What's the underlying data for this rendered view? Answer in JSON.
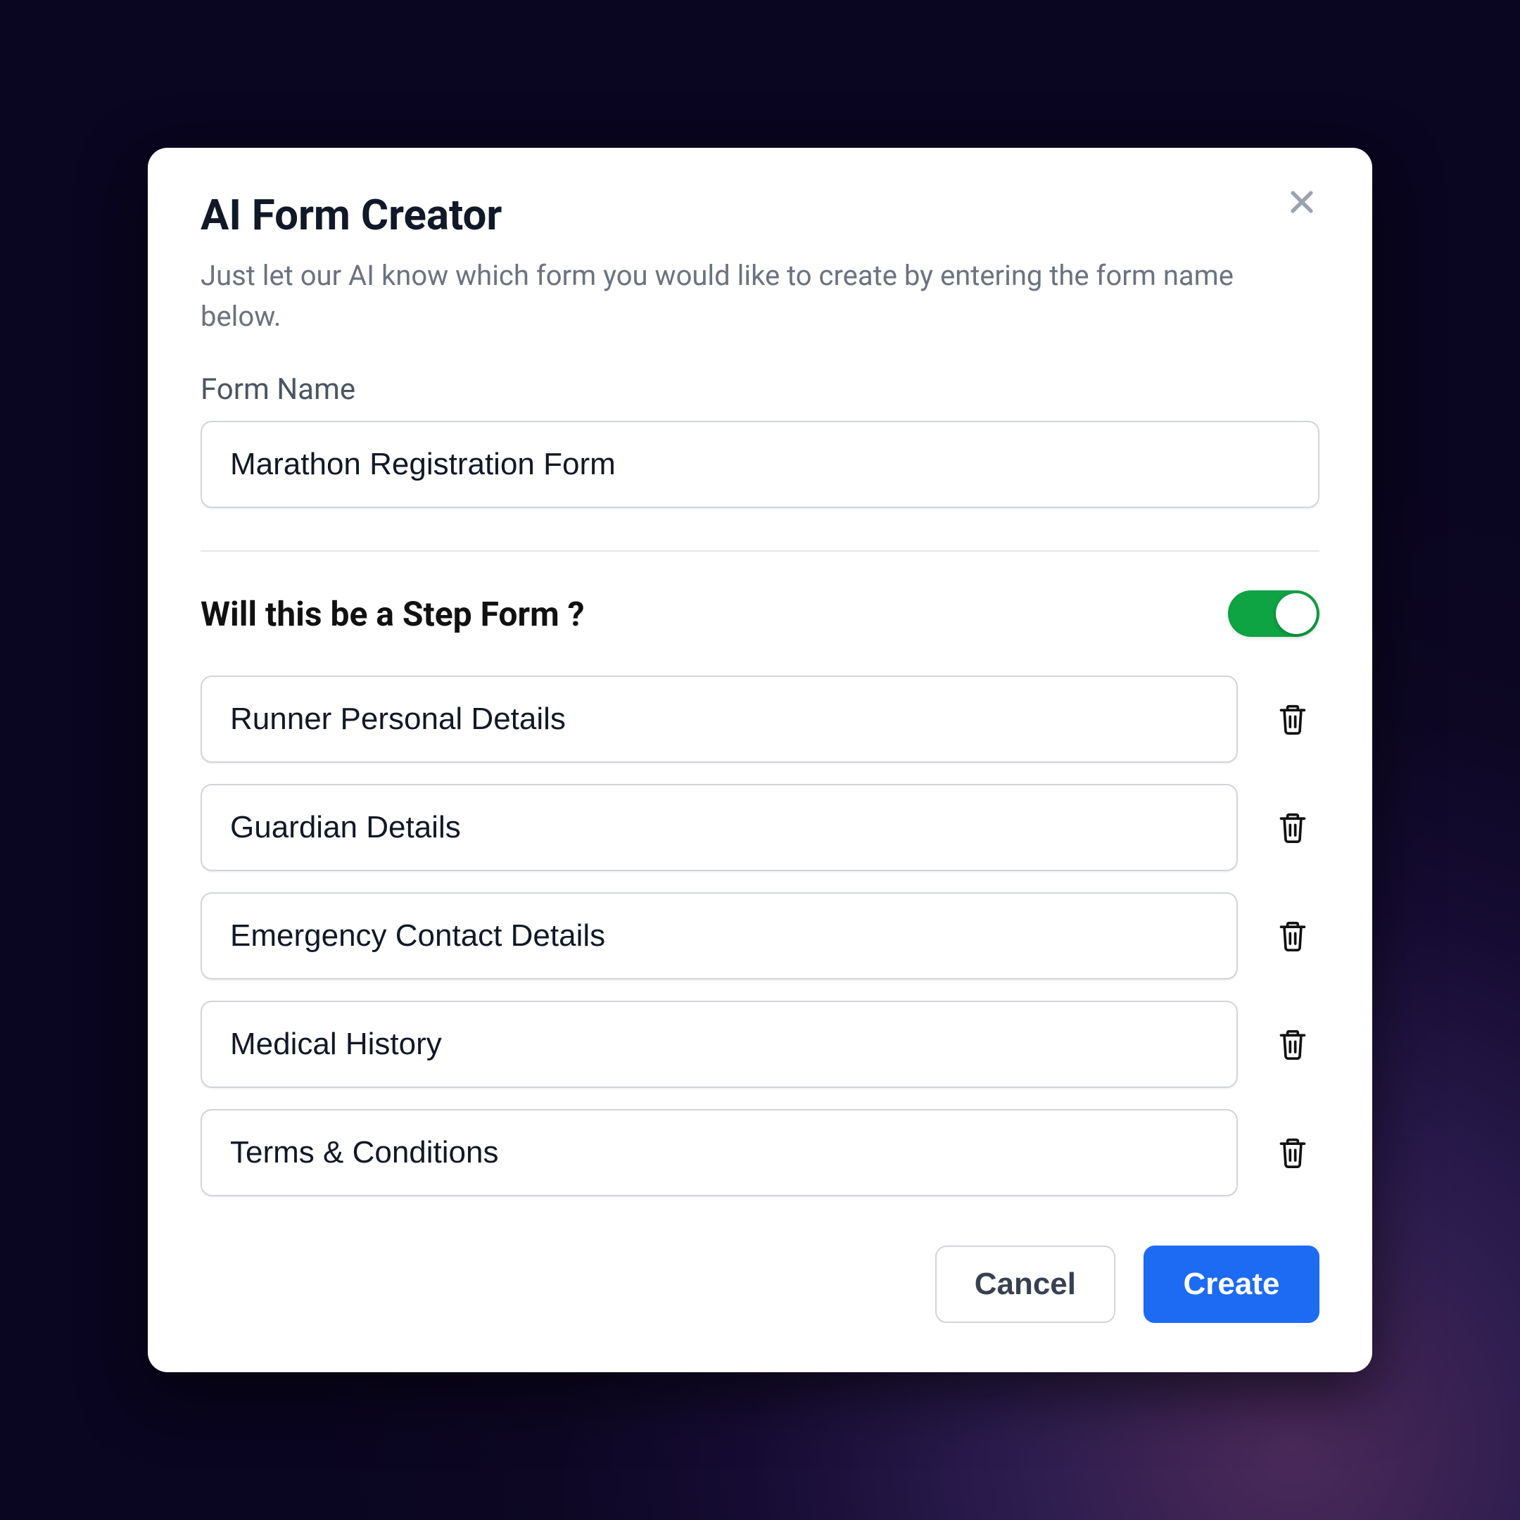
{
  "modal": {
    "title": "AI Form Creator",
    "subtitle": "Just let our AI know which form you would like to create by entering the form name below.",
    "form_name_label": "Form Name",
    "form_name_value": "Marathon Registration Form",
    "step_question": "Will this be a Step Form ?",
    "step_toggle_on": true,
    "steps": [
      {
        "label": "Runner Personal Details"
      },
      {
        "label": "Guardian Details"
      },
      {
        "label": "Emergency Contact Details"
      },
      {
        "label": "Medical History"
      },
      {
        "label": "Terms & Conditions"
      }
    ],
    "cancel_label": "Cancel",
    "create_label": "Create"
  },
  "colors": {
    "accent_primary": "#1d6bf3",
    "toggle_on": "#0ea343"
  }
}
